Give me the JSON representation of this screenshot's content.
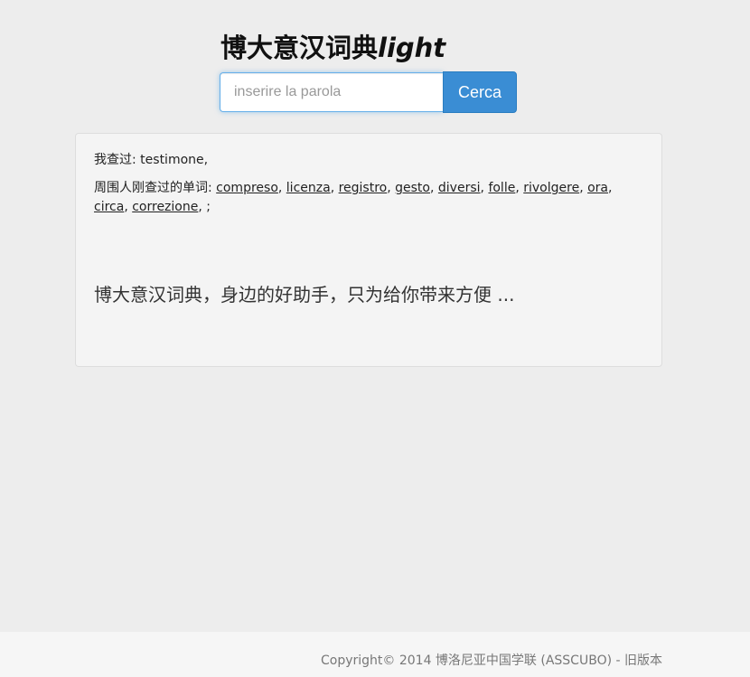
{
  "header": {
    "title_main": "博大意汉词典",
    "title_suffix": "light"
  },
  "search": {
    "placeholder": "inserire la parola",
    "value": "",
    "button_label": "Cerca"
  },
  "panel": {
    "history_label": "我查过:",
    "history_words": [
      "testimone"
    ],
    "others_label": "周围人刚查过的单词:",
    "others_words": [
      "compreso",
      "licenza",
      "registro",
      "gesto",
      "diversi",
      "folle",
      "rivolgere",
      "ora",
      "circa",
      "correzione"
    ],
    "slogan": "博大意汉词典，身边的好助手，只为给你带来方便 ..."
  },
  "footer": {
    "copyright": "Copyright© 2014 博洛尼亚中国学联 (ASSCUBO) - ",
    "old_version_link": "旧版本"
  }
}
